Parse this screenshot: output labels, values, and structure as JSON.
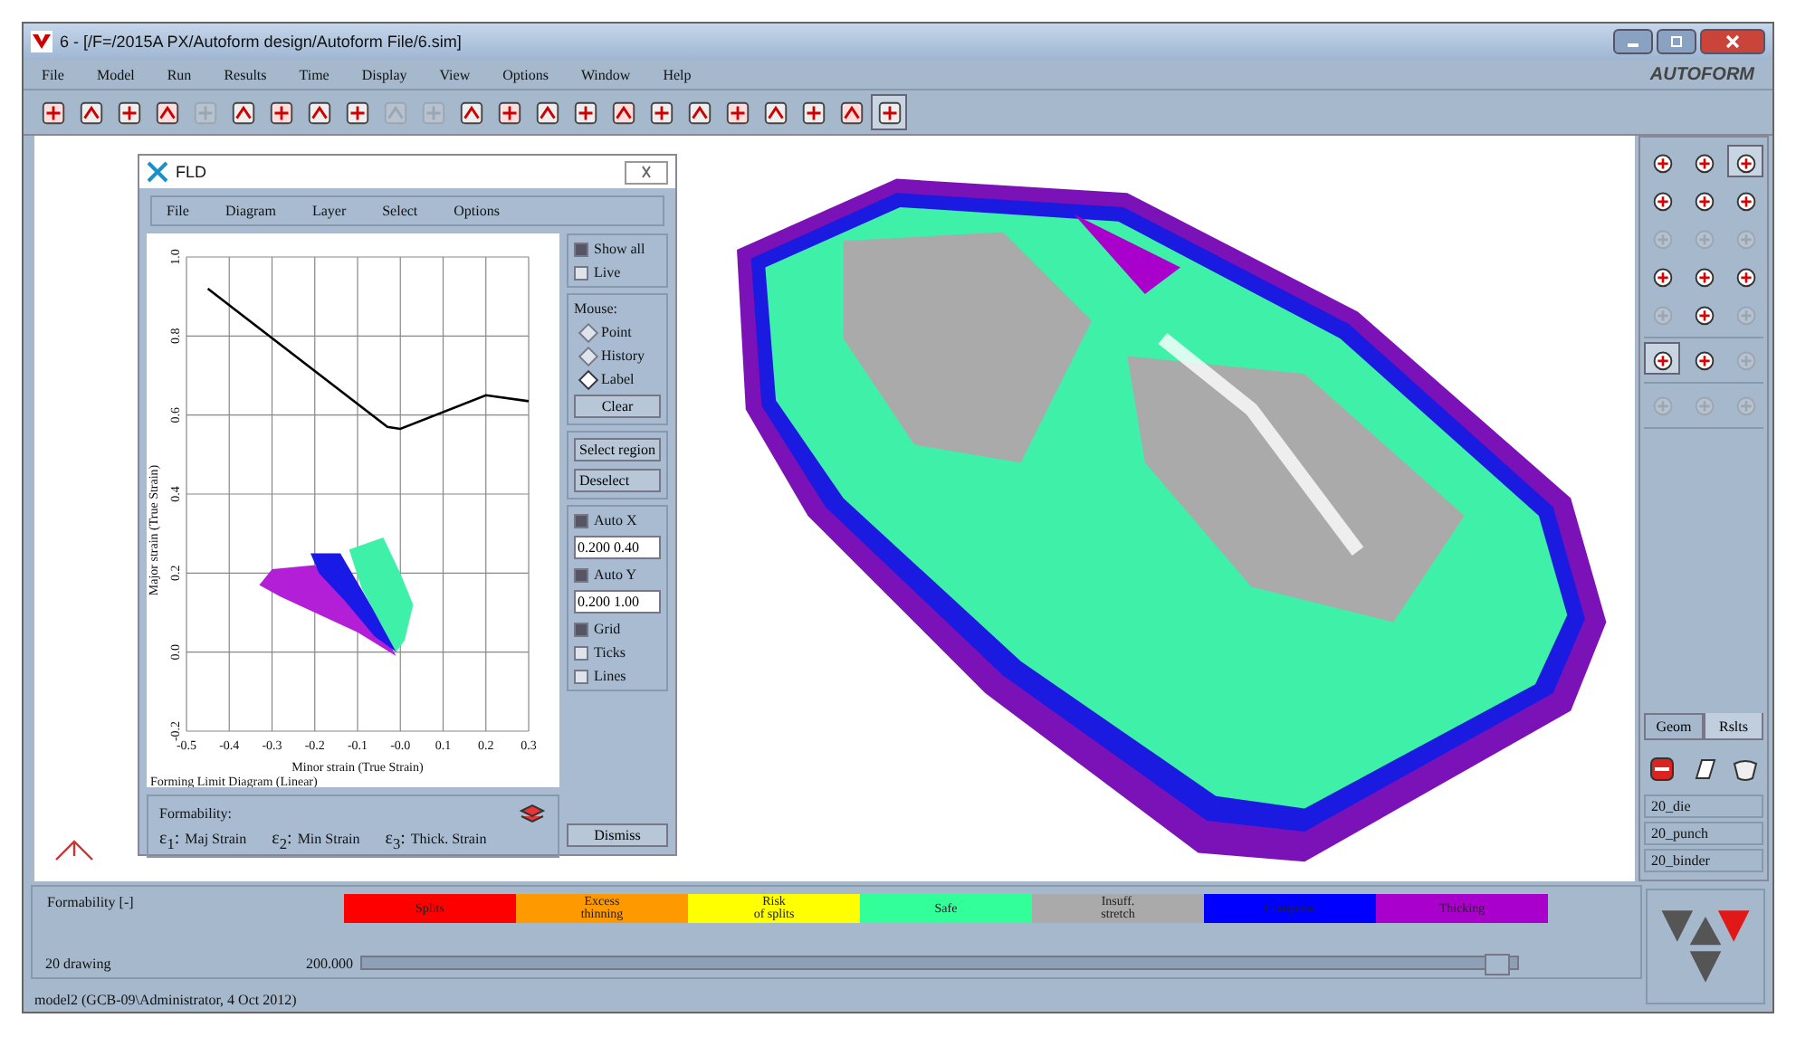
{
  "window": {
    "title": "6 - [/F=/2015A PX/Autoform design/Autoform File/6.sim]",
    "logo": "AUTOFORM"
  },
  "menu": [
    "File",
    "Model",
    "Run",
    "Results",
    "Time",
    "Display",
    "View",
    "Options",
    "Window",
    "Help"
  ],
  "toolbar": [
    {
      "disabled": false,
      "selected": false
    },
    {
      "disabled": false,
      "selected": false
    },
    {
      "disabled": false,
      "selected": false
    },
    {
      "disabled": false,
      "selected": false
    },
    {
      "disabled": true,
      "selected": false
    },
    {
      "disabled": false,
      "selected": false
    },
    {
      "disabled": false,
      "selected": false
    },
    {
      "disabled": false,
      "selected": false
    },
    {
      "disabled": false,
      "selected": false
    },
    {
      "disabled": true,
      "selected": false
    },
    {
      "disabled": true,
      "selected": false
    },
    {
      "disabled": false,
      "selected": false
    },
    {
      "disabled": false,
      "selected": false
    },
    {
      "disabled": false,
      "selected": false
    },
    {
      "disabled": false,
      "selected": false
    },
    {
      "disabled": false,
      "selected": false
    },
    {
      "disabled": false,
      "selected": false
    },
    {
      "disabled": false,
      "selected": false
    },
    {
      "disabled": false,
      "selected": false
    },
    {
      "disabled": false,
      "selected": false
    },
    {
      "disabled": false,
      "selected": false
    },
    {
      "disabled": false,
      "selected": false
    },
    {
      "disabled": false,
      "selected": true
    }
  ],
  "fld": {
    "title": "FLD",
    "menu": [
      "File",
      "Diagram",
      "Layer",
      "Select",
      "Options"
    ],
    "chart_data": {
      "type": "line",
      "title": "Forming Limit Diagram (Linear)",
      "xlabel": "Minor strain (True Strain)",
      "ylabel": "Major strain (True Strain)",
      "xlim": [
        -0.5,
        0.3
      ],
      "ylim": [
        -0.2,
        1.0
      ],
      "xticks": [
        {
          "value": -0.5,
          "label": "-0.5"
        },
        {
          "value": -0.4,
          "label": "-0.4"
        },
        {
          "value": -0.3,
          "label": "-0.3"
        },
        {
          "value": -0.2,
          "label": "-0.2"
        },
        {
          "value": -0.1,
          "label": "-0.1"
        },
        {
          "value": 0,
          "label": "-0.0"
        },
        {
          "value": 0.1,
          "label": "0.1"
        },
        {
          "value": 0.2,
          "label": "0.2"
        },
        {
          "value": 0.3,
          "label": "0.3"
        }
      ],
      "yticks": [
        {
          "value": -0.2,
          "label": "-0.2"
        },
        {
          "value": 0,
          "label": "0.0"
        },
        {
          "value": 0.2,
          "label": "0.2"
        },
        {
          "value": 0.4,
          "label": "0.4"
        },
        {
          "value": 0.6,
          "label": "0.6"
        },
        {
          "value": 0.8,
          "label": "0.8"
        },
        {
          "value": 1.0,
          "label": "1.0"
        }
      ],
      "x": [
        -0.45,
        -0.03,
        0.0,
        0.2,
        0.3
      ],
      "grid": true,
      "series": [
        {
          "color": "#000000",
          "values": [
            0.92,
            0.57,
            0.565,
            0.65,
            0.635
          ]
        }
      ]
    },
    "display": [
      {
        "kind": "checkbox",
        "label": "Show all",
        "checked": true
      },
      {
        "kind": "checkbox",
        "label": "Live",
        "checked": false
      }
    ],
    "mouse": {
      "label": "Mouse:",
      "options": [
        {
          "label": "Point",
          "selected": false
        },
        {
          "label": "History",
          "selected": false
        },
        {
          "label": "Label",
          "selected": true
        }
      ],
      "button": "Clear"
    },
    "region_buttons": [
      "Select region",
      "Deselect"
    ],
    "axes": [
      {
        "label": "Auto X",
        "checked": true,
        "value": "0.200 0.40"
      },
      {
        "label": "Auto Y",
        "checked": true,
        "value": "0.200 1.00"
      }
    ],
    "options": [
      {
        "label": "Grid",
        "checked": true
      },
      {
        "label": "Ticks",
        "checked": false
      },
      {
        "label": "Lines",
        "checked": false
      }
    ],
    "formability": {
      "label": "Formability:",
      "strains": [
        {
          "symbol": "ε$_{1}$:",
          "label": "Maj Strain"
        },
        {
          "symbol": "ε$_{2}$:",
          "label": "Min Strain"
        },
        {
          "symbol": "ε$_{3}$:",
          "label": "Thick. Strain"
        }
      ]
    },
    "dismiss": "Dismiss"
  },
  "palette": {
    "groups": [
      [
        {
          "disabled": false,
          "selected": false
        },
        {
          "disabled": false,
          "selected": false
        },
        {
          "disabled": false,
          "selected": true
        },
        {
          "disabled": false,
          "selected": false
        },
        {
          "disabled": false,
          "selected": false
        },
        {
          "disabled": false,
          "selected": false
        },
        {
          "disabled": true,
          "selected": false
        },
        {
          "disabled": true,
          "selected": false
        },
        {
          "disabled": true,
          "selected": false
        },
        {
          "disabled": false,
          "selected": false
        },
        {
          "disabled": false,
          "selected": false
        },
        {
          "disabled": false,
          "selected": false
        },
        {
          "disabled": true,
          "selected": false
        },
        {
          "disabled": false,
          "selected": false
        },
        {
          "disabled": true,
          "selected": false
        }
      ],
      [
        {
          "disabled": false,
          "selected": true
        },
        {
          "disabled": false,
          "selected": false
        },
        {
          "disabled": true,
          "selected": false
        }
      ],
      [
        {
          "disabled": true,
          "selected": false
        },
        {
          "disabled": true,
          "selected": false
        },
        {
          "disabled": true,
          "selected": false
        }
      ]
    ],
    "tabs": [
      {
        "label": "Geom",
        "selected": false
      },
      {
        "label": "Rslts",
        "selected": true
      }
    ],
    "objects": [
      "20_die",
      "20_punch",
      "20_binder"
    ]
  },
  "legend": {
    "label": "Formability [-]",
    "items": [
      {
        "label": "Splits",
        "color": "#ff0000"
      },
      {
        "label": "Excess\nthinning",
        "color": "#ff9900"
      },
      {
        "label": "Risk\nof splits",
        "color": "#ffff00"
      },
      {
        "label": "Safe",
        "color": "#33ff99"
      },
      {
        "label": "Insuff.\nstretch",
        "color": "#aaaaaa"
      },
      {
        "label": "Compress",
        "color": "#0000ff"
      },
      {
        "label": "Thicking",
        "color": "#aa00cc"
      }
    ]
  },
  "timeline": {
    "label": "20 drawing",
    "value": "200.000",
    "level": 0.99
  },
  "status_bar": "model2 (GCB-09\\Administrator, 4 Oct 2012)"
}
